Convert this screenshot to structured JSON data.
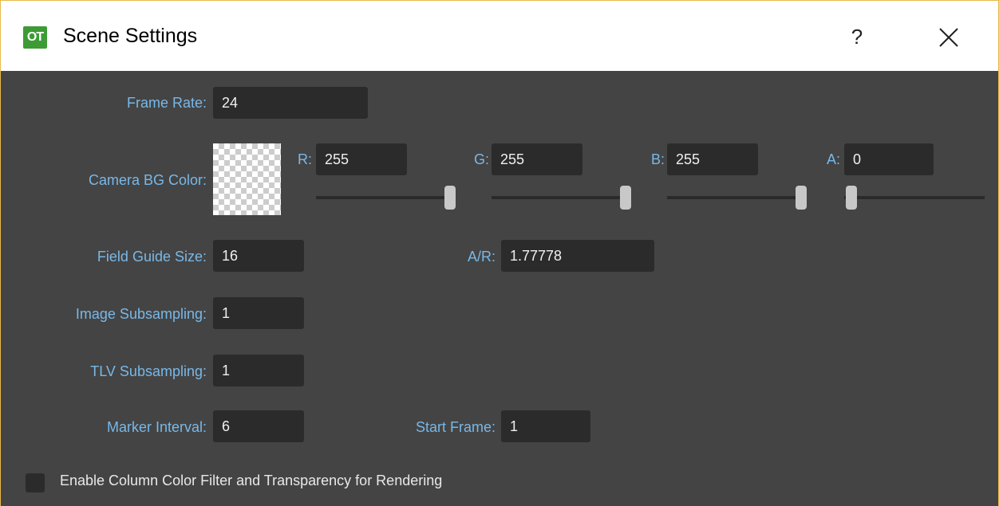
{
  "window": {
    "title": "Scene Settings",
    "icon_text": "OT",
    "help_label": "?",
    "close_icon": "close-icon"
  },
  "form": {
    "frame_rate": {
      "label": "Frame Rate:",
      "value": "24"
    },
    "camera_bg": {
      "label": "Camera BG Color:",
      "r": {
        "label": "R:",
        "value": "255",
        "level": 255
      },
      "g": {
        "label": "G:",
        "value": "255",
        "level": 255
      },
      "b": {
        "label": "B:",
        "value": "255",
        "level": 255
      },
      "a": {
        "label": "A:",
        "value": "0",
        "level": 0
      }
    },
    "field_guide_size": {
      "label": "Field Guide Size:",
      "value": "16"
    },
    "aspect_ratio": {
      "label": "A/R:",
      "value": "1.77778"
    },
    "image_subsampling": {
      "label": "Image Subsampling:",
      "value": "1"
    },
    "tlv_subsampling": {
      "label": "TLV Subsampling:",
      "value": "1"
    },
    "marker_interval": {
      "label": "Marker Interval:",
      "value": "6"
    },
    "start_frame": {
      "label": "Start Frame:",
      "value": "1"
    },
    "column_filter": {
      "label": "Enable Column Color Filter and Transparency for Rendering",
      "checked": false
    }
  },
  "colors": {
    "background": "#444444",
    "label": "#78b8e8",
    "field": "#2b2b2b",
    "accent_border": "#e8b84a",
    "app_icon": "#3d9b35"
  }
}
